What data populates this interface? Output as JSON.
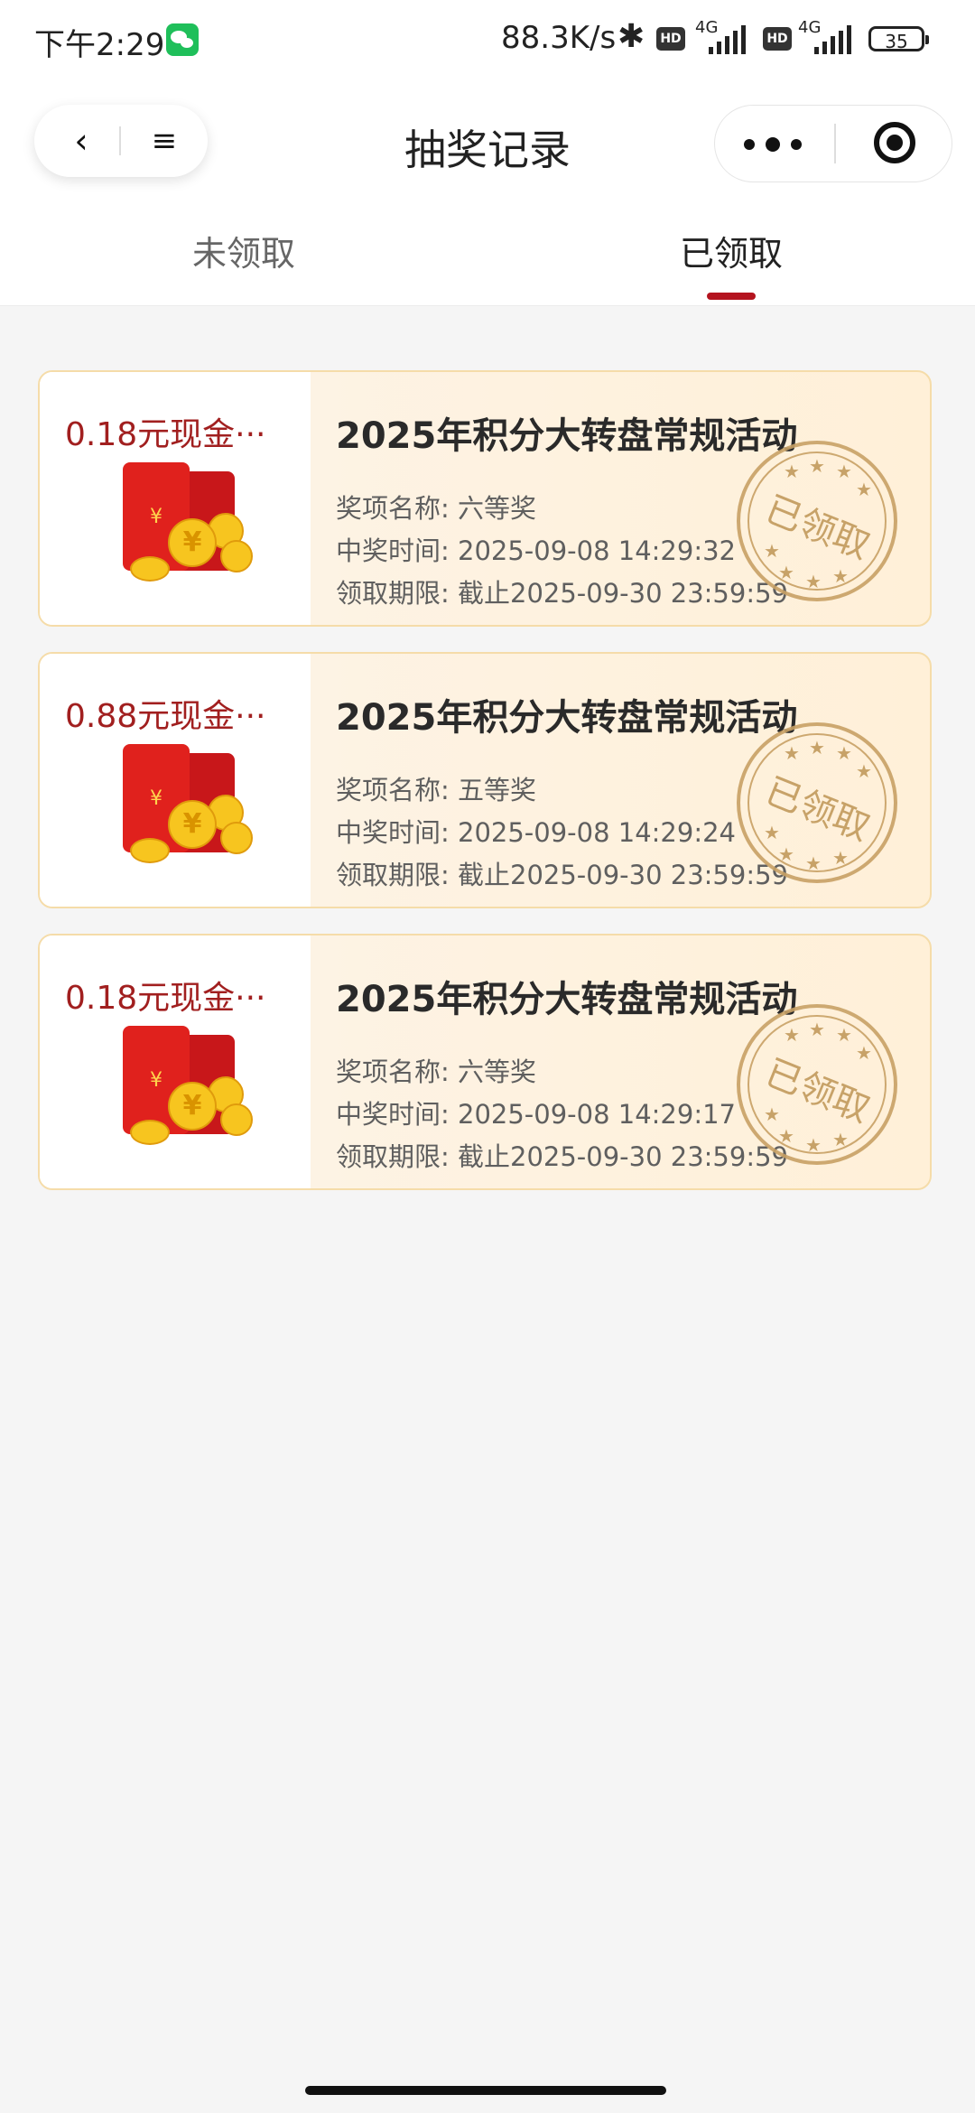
{
  "status_bar": {
    "time": "下午2:29",
    "speed": "88.3K/s",
    "bluetooth_icon": "✱",
    "hd_label": "HD",
    "network_label": "4G",
    "battery": "35"
  },
  "nav": {
    "back_icon": "‹",
    "menu_icon": "≡",
    "title": "抽奖记录"
  },
  "tabs": [
    {
      "label": "未领取",
      "active": false
    },
    {
      "label": "已领取",
      "active": true
    }
  ],
  "records": [
    {
      "amount": "0.18元现金···",
      "title": "2025年积分大转盘常规活动",
      "prize": "奖项名称: 六等奖",
      "time": "中奖时间: 2025-09-08 14:29:32",
      "deadline": "领取期限: 截止2025-09-30 23:59:59",
      "stamp": "已领取"
    },
    {
      "amount": "0.88元现金···",
      "title": "2025年积分大转盘常规活动",
      "prize": "奖项名称: 五等奖",
      "time": "中奖时间: 2025-09-08 14:29:24",
      "deadline": "领取期限: 截止2025-09-30 23:59:59",
      "stamp": "已领取"
    },
    {
      "amount": "0.18元现金···",
      "title": "2025年积分大转盘常规活动",
      "prize": "奖项名称: 六等奖",
      "time": "中奖时间: 2025-09-08 14:29:17",
      "deadline": "领取期限: 截止2025-09-30 23:59:59",
      "stamp": "已领取"
    }
  ],
  "envelope_symbol": "¥",
  "colors": {
    "accent": "#b4141f",
    "amount": "#a11f1f",
    "stamp": "#c29a5c",
    "card_border": "#f5dca9"
  }
}
